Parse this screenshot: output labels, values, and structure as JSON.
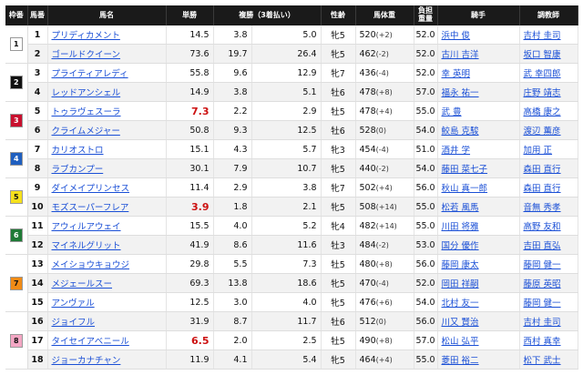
{
  "headers": [
    "枠番",
    "馬番",
    "馬名",
    "単勝",
    "複勝（3着払い）",
    "性齢",
    "馬体重",
    "負担\n重量",
    "騎手",
    "調教師"
  ],
  "waku_colors": {
    "1": "#ffffff",
    "2": "#111111",
    "3": "#c8102e",
    "4": "#1f5fbf",
    "5": "#f6e11c",
    "6": "#1f7a36",
    "7": "#f08b16",
    "8": "#f4a7c4"
  },
  "rows": [
    {
      "waku": "1",
      "no": "1",
      "name": "プリディカメント",
      "win": "14.5",
      "place_lo": "3.8",
      "place_hi": "5.0",
      "sexage": "牝5",
      "weight": "520",
      "diff": "(+2)",
      "load": "52.0",
      "jockey": "浜中 俊",
      "trainer": "吉村 圭司",
      "hot": false
    },
    {
      "waku": "",
      "no": "2",
      "name": "ゴールドクイーン",
      "win": "73.6",
      "place_lo": "19.7",
      "place_hi": "26.4",
      "sexage": "牝5",
      "weight": "462",
      "diff": "(-2)",
      "load": "52.0",
      "jockey": "古川 吉洋",
      "trainer": "坂口 智康",
      "hot": false
    },
    {
      "waku": "2",
      "no": "3",
      "name": "プライティアレディ",
      "win": "55.8",
      "place_lo": "9.6",
      "place_hi": "12.9",
      "sexage": "牝7",
      "weight": "436",
      "diff": "(-4)",
      "load": "52.0",
      "jockey": "幸 英明",
      "trainer": "武 幸四郎",
      "hot": false
    },
    {
      "waku": "",
      "no": "4",
      "name": "レッドアンシェル",
      "win": "14.9",
      "place_lo": "3.8",
      "place_hi": "5.1",
      "sexage": "牡6",
      "weight": "478",
      "diff": "(+8)",
      "load": "57.0",
      "jockey": "福永 祐一",
      "trainer": "庄野 靖志",
      "hot": false
    },
    {
      "waku": "3",
      "no": "5",
      "name": "トゥラヴェスーラ",
      "win": "7.3",
      "place_lo": "2.2",
      "place_hi": "2.9",
      "sexage": "牡5",
      "weight": "478",
      "diff": "(+4)",
      "load": "55.0",
      "jockey": "武 豊",
      "trainer": "高橋 康之",
      "hot": true
    },
    {
      "waku": "",
      "no": "6",
      "name": "クライムメジャー",
      "win": "50.8",
      "place_lo": "9.3",
      "place_hi": "12.5",
      "sexage": "牡6",
      "weight": "528",
      "diff": "(0)",
      "load": "54.0",
      "jockey": "鮫島 克駿",
      "trainer": "渡辺 薫彦",
      "hot": false
    },
    {
      "waku": "4",
      "no": "7",
      "name": "カリオストロ",
      "win": "15.1",
      "place_lo": "4.3",
      "place_hi": "5.7",
      "sexage": "牝3",
      "weight": "454",
      "diff": "(-4)",
      "load": "51.0",
      "jockey": "酒井 学",
      "trainer": "加用 正",
      "hot": false
    },
    {
      "waku": "",
      "no": "8",
      "name": "ラブカンプー",
      "win": "30.1",
      "place_lo": "7.9",
      "place_hi": "10.7",
      "sexage": "牝5",
      "weight": "440",
      "diff": "(-2)",
      "load": "54.0",
      "jockey": "藤田 菜七子",
      "trainer": "森田 直行",
      "hot": false
    },
    {
      "waku": "5",
      "no": "9",
      "name": "ダイメイプリンセス",
      "win": "11.4",
      "place_lo": "2.9",
      "place_hi": "3.8",
      "sexage": "牝7",
      "weight": "502",
      "diff": "(+4)",
      "load": "56.0",
      "jockey": "秋山 真一郎",
      "trainer": "森田 直行",
      "hot": false
    },
    {
      "waku": "",
      "no": "10",
      "name": "モズスーパーフレア",
      "win": "3.9",
      "place_lo": "1.8",
      "place_hi": "2.1",
      "sexage": "牝5",
      "weight": "508",
      "diff": "(+14)",
      "load": "55.0",
      "jockey": "松若 風馬",
      "trainer": "音無 秀孝",
      "hot": true
    },
    {
      "waku": "6",
      "no": "11",
      "name": "アウィルアウェイ",
      "win": "15.5",
      "place_lo": "4.0",
      "place_hi": "5.2",
      "sexage": "牝4",
      "weight": "482",
      "diff": "(+14)",
      "load": "55.0",
      "jockey": "川田 将雅",
      "trainer": "高野 友和",
      "hot": false
    },
    {
      "waku": "",
      "no": "12",
      "name": "マイネルグリット",
      "win": "41.9",
      "place_lo": "8.6",
      "place_hi": "11.6",
      "sexage": "牡3",
      "weight": "484",
      "diff": "(-2)",
      "load": "53.0",
      "jockey": "国分 優作",
      "trainer": "吉田 直弘",
      "hot": false
    },
    {
      "waku": "7",
      "no": "13",
      "name": "メイショウキョウジ",
      "win": "29.8",
      "place_lo": "5.5",
      "place_hi": "7.3",
      "sexage": "牡5",
      "weight": "480",
      "diff": "(+8)",
      "load": "56.0",
      "jockey": "藤岡 康太",
      "trainer": "藤岡 健一",
      "hot": false
    },
    {
      "waku": "",
      "no": "14",
      "name": "メジェールスー",
      "win": "69.3",
      "place_lo": "13.8",
      "place_hi": "18.6",
      "sexage": "牝5",
      "weight": "470",
      "diff": "(-4)",
      "load": "52.0",
      "jockey": "岡田 祥嗣",
      "trainer": "藤原 英昭",
      "hot": false
    },
    {
      "waku": "",
      "no": "15",
      "name": "アンヴァル",
      "win": "12.5",
      "place_lo": "3.0",
      "place_hi": "4.0",
      "sexage": "牝5",
      "weight": "476",
      "diff": "(+6)",
      "load": "54.0",
      "jockey": "北村 友一",
      "trainer": "藤岡 健一",
      "hot": false
    },
    {
      "waku": "8",
      "no": "16",
      "name": "ジョイフル",
      "win": "31.9",
      "place_lo": "8.7",
      "place_hi": "11.7",
      "sexage": "牡6",
      "weight": "512",
      "diff": "(0)",
      "load": "56.0",
      "jockey": "川又 賢治",
      "trainer": "吉村 圭司",
      "hot": false
    },
    {
      "waku": "",
      "no": "17",
      "name": "タイセイアベニール",
      "win": "6.5",
      "place_lo": "2.0",
      "place_hi": "2.5",
      "sexage": "牡5",
      "weight": "490",
      "diff": "(+8)",
      "load": "57.0",
      "jockey": "松山 弘平",
      "trainer": "西村 真幸",
      "hot": true
    },
    {
      "waku": "",
      "no": "18",
      "name": "ジョーカナチャン",
      "win": "11.9",
      "place_lo": "4.1",
      "place_hi": "5.4",
      "sexage": "牝5",
      "weight": "464",
      "diff": "(+4)",
      "load": "55.0",
      "jockey": "菱田 裕二",
      "trainer": "松下 武士",
      "hot": false
    }
  ]
}
